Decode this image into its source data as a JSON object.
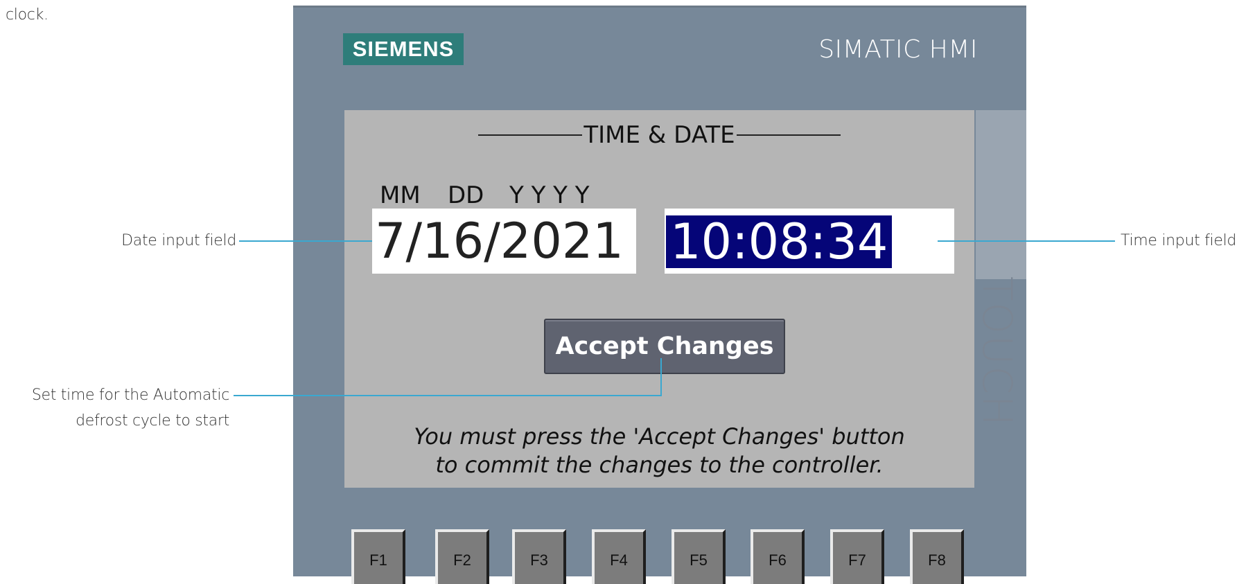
{
  "annotations": {
    "top_fragment": "clock.",
    "date_field": "Date input field",
    "time_field": "Time input field",
    "accept_line1": "Set time for the Automatic",
    "accept_line2": "defrost cycle to start"
  },
  "panel": {
    "logo": "SIEMENS",
    "brand": "SIMATIC HMI",
    "side_label": "TOUCH"
  },
  "screen": {
    "title": "TIME & DATE",
    "headers": {
      "mm": "MM",
      "dd": "DD",
      "yyyy": "Y Y Y Y"
    },
    "date_value": "7/16/2021",
    "time_value": "10:08:34",
    "accept_label": "Accept Changes",
    "notice_line1": "You must press the 'Accept Changes' button",
    "notice_line2": "to commit the changes to the controller."
  },
  "function_keys": [
    "F1",
    "F2",
    "F3",
    "F4",
    "F5",
    "F6",
    "F7",
    "F8"
  ],
  "colors": {
    "panel": "#778899",
    "screen": "#b5b5b5",
    "logo": "#2e7d7a",
    "time_selection": "#050578",
    "leader_line": "#3aa8d0"
  }
}
